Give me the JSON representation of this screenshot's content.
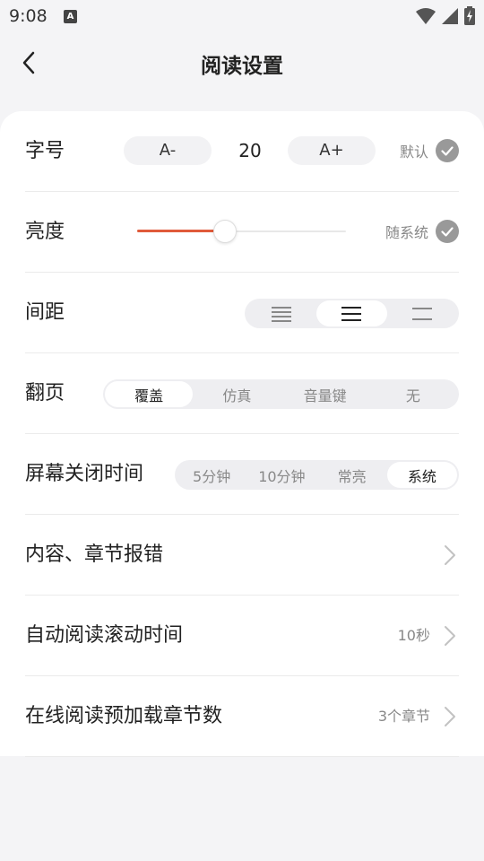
{
  "status_bar": {
    "time": "9:08",
    "notification_icon": "a-square-icon"
  },
  "header": {
    "title": "阅读设置"
  },
  "font_size": {
    "label": "字号",
    "decrease_label": "A-",
    "value": "20",
    "increase_label": "A+",
    "default_label": "默认",
    "default_checked": true
  },
  "brightness": {
    "label": "亮度",
    "level": 0.4,
    "follow_system_label": "随系统",
    "follow_system_checked": true
  },
  "spacing": {
    "label": "间距",
    "options": [
      "compact-lines-icon",
      "normal-lines-icon",
      "wide-lines-icon"
    ],
    "selected_index": 1
  },
  "page_turn": {
    "label": "翻页",
    "options": [
      "覆盖",
      "仿真",
      "音量键",
      "无"
    ],
    "selected_index": 0
  },
  "screen_timeout": {
    "label": "屏幕关闭时间",
    "options": [
      "5分钟",
      "10分钟",
      "常亮",
      "系统"
    ],
    "selected_index": 3
  },
  "report_error": {
    "label": "内容、章节报错"
  },
  "auto_scroll": {
    "label": "自动阅读滚动时间",
    "value": "10秒"
  },
  "preload": {
    "label": "在线阅读预加载章节数",
    "value": "3个章节"
  },
  "colors": {
    "accent": "#e05a3a",
    "check": "#999999",
    "segment_bg": "#eeeef1",
    "page_bg": "#f4f4f6"
  }
}
